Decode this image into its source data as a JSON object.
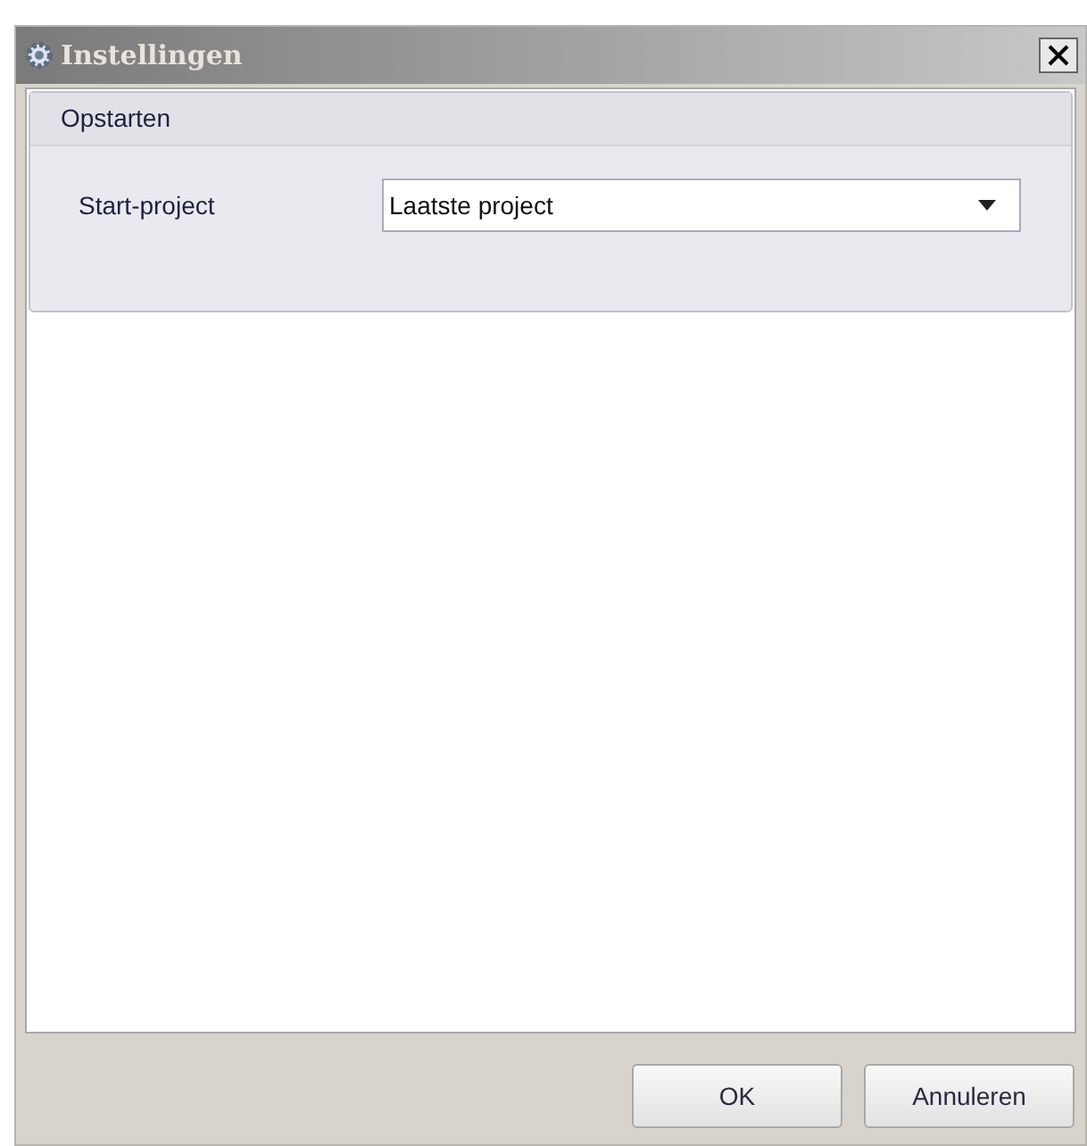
{
  "window": {
    "title": "Instellingen"
  },
  "group": {
    "title": "Opstarten",
    "label": "Start-project",
    "value": "Laatste project"
  },
  "buttons": [
    "OK",
    "Annuleren"
  ]
}
